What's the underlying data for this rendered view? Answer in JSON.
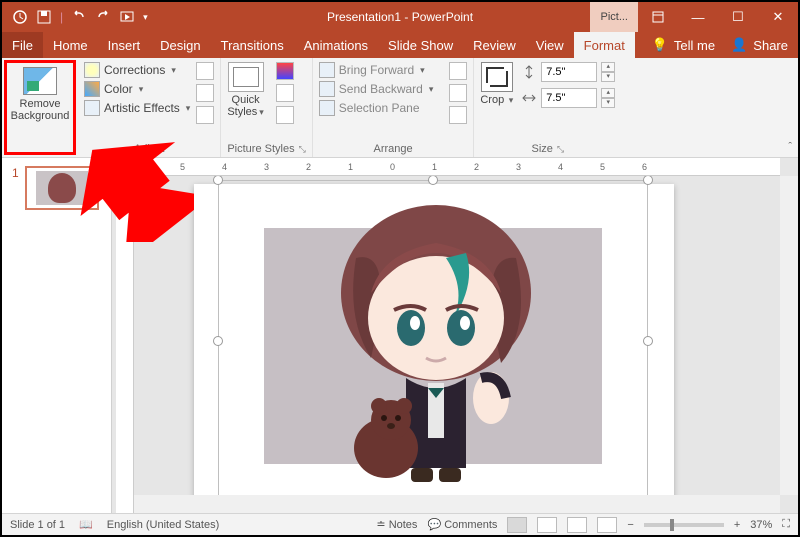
{
  "title": {
    "doc": "Presentation1",
    "app": "PowerPoint",
    "context": "Pict..."
  },
  "qat": {
    "autosave": "autosave",
    "save": "save",
    "undo": "undo",
    "redo": "redo",
    "start": "start-from-beginning"
  },
  "tabs": {
    "file": "File",
    "home": "Home",
    "insert": "Insert",
    "design": "Design",
    "transitions": "Transitions",
    "animations": "Animations",
    "slideshow": "Slide Show",
    "review": "Review",
    "view": "View",
    "format": "Format",
    "tellme": "Tell me",
    "share": "Share"
  },
  "ribbon": {
    "removebg": {
      "line1": "Remove",
      "line2": "Background"
    },
    "adjust": {
      "corrections": "Corrections",
      "color": "Color",
      "artistic": "Artistic Effects",
      "label": "Adjust"
    },
    "pstyles": {
      "quick": "Quick",
      "styles": "Styles",
      "label": "Picture Styles"
    },
    "arrange": {
      "bringfwd": "Bring Forward",
      "sendback": "Send Backward",
      "selpane": "Selection Pane",
      "label": "Arrange"
    },
    "size": {
      "crop": "Crop",
      "height": "7.5\"",
      "width": "7.5\"",
      "label": "Size"
    }
  },
  "ruler": [
    "6",
    "5",
    "4",
    "3",
    "2",
    "1",
    "0",
    "1",
    "2",
    "3",
    "4",
    "5",
    "6"
  ],
  "slidepane": {
    "num": "1"
  },
  "status": {
    "slide": "Slide 1 of 1",
    "lang": "English (United States)",
    "notes": "Notes",
    "comments": "Comments",
    "zoom": "37%"
  }
}
